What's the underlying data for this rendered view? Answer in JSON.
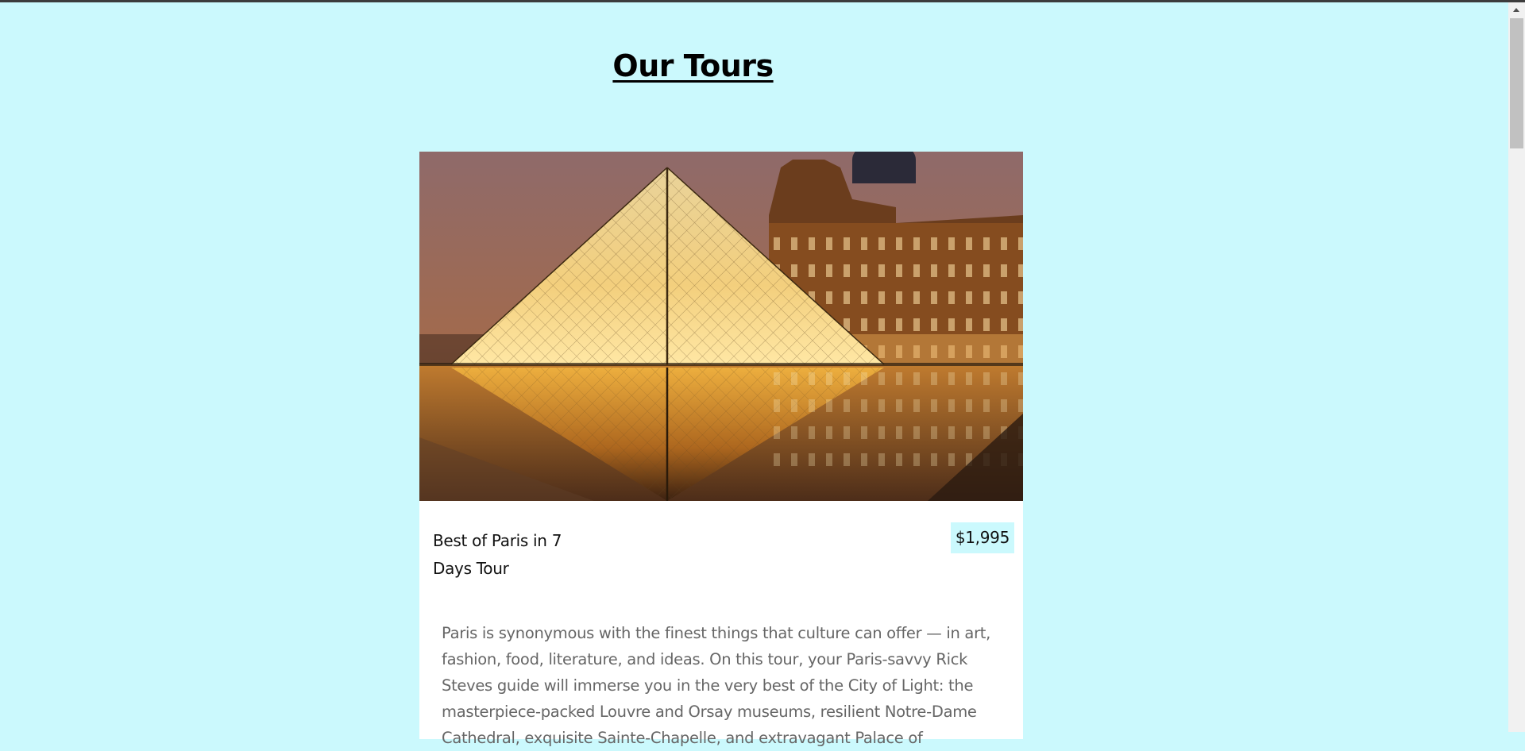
{
  "page": {
    "heading": "Our Tours"
  },
  "tours": [
    {
      "name": "Best of Paris in 7 Days Tour",
      "price": "$1,995",
      "image": "louvre-pyramid-night-photo",
      "description": "Paris is synonymous with the finest things that culture can offer — in art, fashion, food, literature, and ideas. On this tour, your Paris-savvy Rick Steves guide will immerse you in the very best of the City of Light: the masterpiece-packed Louvre and Orsay museums, resilient Notre-Dame Cathedral, exquisite Sainte-Chapelle, and extravagant Palace of"
    }
  ],
  "colors": {
    "background": "#cbf9fd",
    "card": "#ffffff",
    "price_badge": "#cbf9fd",
    "description_text": "#666666"
  }
}
